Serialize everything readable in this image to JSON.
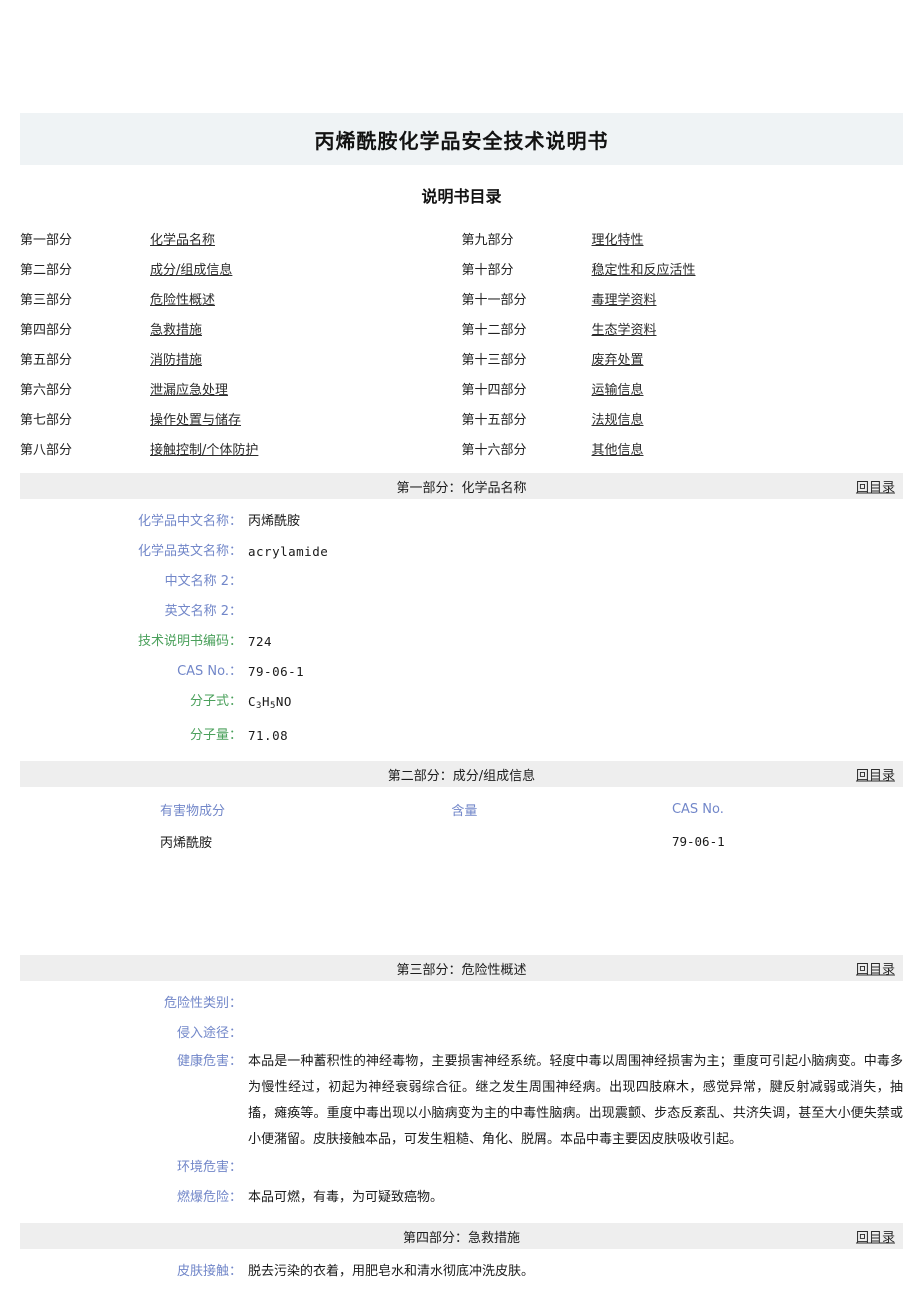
{
  "document": {
    "title": "丙烯酰胺化学品安全技术说明书",
    "subtitle": "说明书目录",
    "back_to_toc_label": "回目录"
  },
  "toc": {
    "left": [
      {
        "num": "第一部分",
        "link": "化学品名称"
      },
      {
        "num": "第二部分",
        "link": "成分/组成信息"
      },
      {
        "num": "第三部分",
        "link": "危险性概述"
      },
      {
        "num": "第四部分",
        "link": "急救措施"
      },
      {
        "num": "第五部分",
        "link": "消防措施"
      },
      {
        "num": "第六部分",
        "link": "泄漏应急处理"
      },
      {
        "num": "第七部分",
        "link": "操作处置与储存"
      },
      {
        "num": "第八部分",
        "link": "接触控制/个体防护"
      }
    ],
    "right": [
      {
        "num": "第九部分",
        "link": "理化特性"
      },
      {
        "num": "第十部分",
        "link": "稳定性和反应活性"
      },
      {
        "num": "第十一部分",
        "link": "毒理学资料"
      },
      {
        "num": "第十二部分",
        "link": "生态学资料"
      },
      {
        "num": "第十三部分",
        "link": "废弃处置"
      },
      {
        "num": "第十四部分",
        "link": "运输信息"
      },
      {
        "num": "第十五部分",
        "link": "法规信息"
      },
      {
        "num": "第十六部分",
        "link": "其他信息"
      }
    ]
  },
  "section1": {
    "header": "第一部分：化学品名称",
    "fields": [
      {
        "label": "化学品中文名称：",
        "value": "丙烯酰胺",
        "color": "blue",
        "mono": false
      },
      {
        "label": "化学品英文名称：",
        "value": "acrylamide",
        "color": "blue",
        "mono": true
      },
      {
        "label": "中文名称 2：",
        "value": "",
        "color": "blue",
        "mono": false
      },
      {
        "label": "英文名称 2：",
        "value": "",
        "color": "blue",
        "mono": false
      },
      {
        "label": "技术说明书编码：",
        "value": "724",
        "color": "green",
        "mono": true
      },
      {
        "label": "CAS No.：",
        "value": "79-06-1",
        "color": "blue",
        "mono": true
      },
      {
        "label": "分子式：",
        "value": "C3H5NO",
        "color": "green",
        "mono": true
      },
      {
        "label": "分子量：",
        "value": "71.08",
        "color": "green",
        "mono": true
      }
    ],
    "molecular_formula": {
      "parts": [
        {
          "t": "C",
          "sub": false
        },
        {
          "t": "3",
          "sub": true
        },
        {
          "t": "H",
          "sub": false
        },
        {
          "t": "5",
          "sub": true
        },
        {
          "t": "NO",
          "sub": false
        }
      ]
    }
  },
  "section2": {
    "header": "第二部分：成分/组成信息",
    "columns": [
      "有害物成分",
      "含量",
      "CAS No."
    ],
    "rows": [
      {
        "name": "丙烯酰胺",
        "amount": "",
        "cas": "79-06-1"
      }
    ]
  },
  "section3": {
    "header": "第三部分：危险性概述",
    "fields": [
      {
        "label": "危险性类别：",
        "value": ""
      },
      {
        "label": "侵入途径：",
        "value": ""
      },
      {
        "label": "健康危害：",
        "value": "本品是一种蓄积性的神经毒物，主要损害神经系统。轻度中毒以周围神经损害为主；重度可引起小脑病变。中毒多为慢性经过，初起为神经衰弱综合征。继之发生周围神经病。出现四肢麻木，感觉异常，腱反射减弱或消失，抽搐，瘫痪等。重度中毒出现以小脑病变为主的中毒性脑病。出现震颤、步态反紊乱、共济失调，甚至大小便失禁或小便潴留。皮肤接触本品，可发生粗糙、角化、脱屑。本品中毒主要因皮肤吸收引起。"
      },
      {
        "label": "环境危害：",
        "value": ""
      },
      {
        "label": "燃爆危险：",
        "value": "本品可燃，有毒，为可疑致癌物。"
      }
    ]
  },
  "section4": {
    "header": "第四部分：急救措施",
    "fields": [
      {
        "label": "皮肤接触：",
        "value": "脱去污染的衣着，用肥皂水和清水彻底冲洗皮肤。"
      }
    ]
  },
  "colors": {
    "title_bar_bg": "#eff3f5",
    "section_bar_bg": "#eeeeee",
    "label_blue": "#7287c9",
    "label_green": "#4aa05b",
    "text": "#1a1a1a"
  }
}
